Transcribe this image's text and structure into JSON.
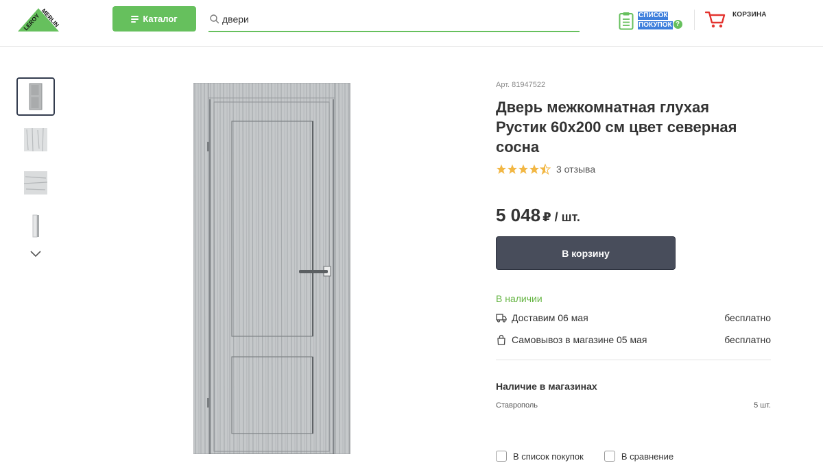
{
  "brand": {
    "logo_text_1": "LEROY",
    "logo_text_2": "MERLIN"
  },
  "header": {
    "catalog_label": "Каталог",
    "search_value": "двери",
    "shoplist_line1": "СПИСОК",
    "shoplist_line2": "ПОКУПОК",
    "shoplist_help": "?",
    "cart_label": "КОРЗИНА"
  },
  "product": {
    "article": "Арт. 81947522",
    "title": "Дверь межкомнатная глухая Рустик 60x200 см цвет северная сосна",
    "rating": 4.5,
    "reviews": "3 отзыва",
    "price": "5 048",
    "price_unit": "₽ / шт.",
    "buy_label": "В корзину",
    "stock_status": "В наличии",
    "delivery": [
      {
        "icon": "truck-icon",
        "label": "Доставим 06 мая",
        "cost": "бесплатно"
      },
      {
        "icon": "bag-icon",
        "label": "Самовывоз в магазине 05 мая",
        "cost": "бесплатно"
      }
    ],
    "stores_title": "Наличие в магазинах",
    "stores": [
      {
        "city": "Ставрополь",
        "qty": "5 шт."
      }
    ],
    "add_to_list": "В список покупок",
    "add_to_compare": "В сравнение"
  },
  "colors": {
    "accent_green": "#66c05d",
    "dark_button": "#484d5b",
    "stock_green": "#66b544",
    "star": "#f2b744"
  }
}
